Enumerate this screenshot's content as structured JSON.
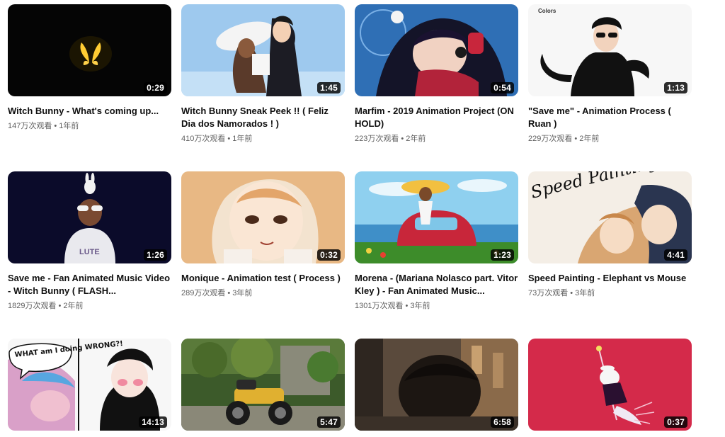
{
  "videos": [
    {
      "title": "Witch Bunny - What's coming up...",
      "views": "147万次观看",
      "age": "1年前",
      "duration": "0:29"
    },
    {
      "title": "Witch Bunny Sneak Peek !! ( Feliz Dia dos Namorados ! )",
      "views": "410万次观看",
      "age": "1年前",
      "duration": "1:45"
    },
    {
      "title": "Marfim - 2019 Animation Project (ON HOLD)",
      "views": "223万次观看",
      "age": "2年前",
      "duration": "0:54"
    },
    {
      "title": "\"Save me\" - Animation Process ( Ruan )",
      "views": "229万次观看",
      "age": "2年前",
      "duration": "1:13",
      "thumb_text": "Colors"
    },
    {
      "title": "Save me - Fan Animated Music Video - Witch Bunny ( FLASH...",
      "views": "1829万次观看",
      "age": "2年前",
      "duration": "1:26",
      "thumb_text": "LUTE"
    },
    {
      "title": "Monique - Animation test ( Process )",
      "views": "289万次观看",
      "age": "3年前",
      "duration": "0:32"
    },
    {
      "title": "Morena - (Mariana Nolasco part. Vitor Kley ) - Fan Animated Music...",
      "views": "1301万次观看",
      "age": "3年前",
      "duration": "1:23"
    },
    {
      "title": "Speed Painting - Elephant vs Mouse",
      "views": "73万次观看",
      "age": "3年前",
      "duration": "4:41",
      "thumb_text": "Speed Painting"
    },
    {
      "title": "",
      "views": "",
      "age": "",
      "duration": "14:13",
      "thumb_text": "WHAT am I doing WRONG?!"
    },
    {
      "title": "",
      "views": "",
      "age": "",
      "duration": "5:47"
    },
    {
      "title": "",
      "views": "",
      "age": "",
      "duration": "6:58"
    },
    {
      "title": "",
      "views": "",
      "age": "",
      "duration": "0:37"
    }
  ],
  "separator": "•"
}
